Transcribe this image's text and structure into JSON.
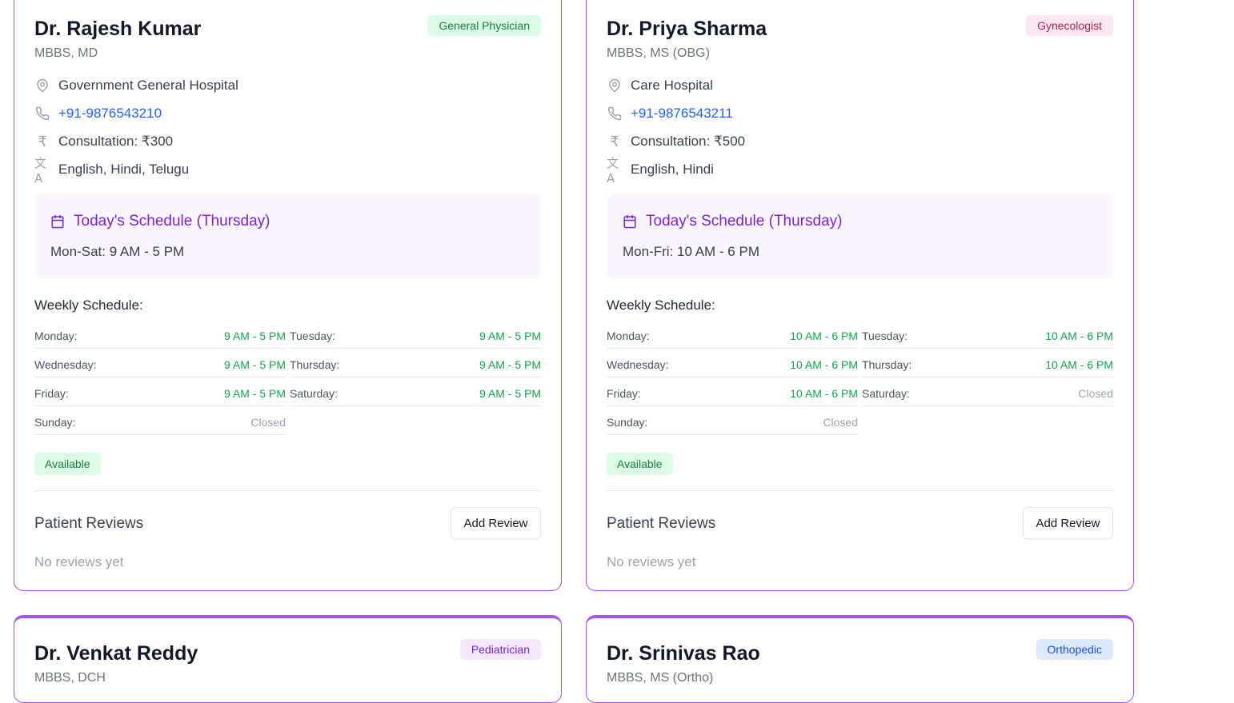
{
  "colors": {
    "accent": "#a855f7",
    "available_bg": "#dcfce7",
    "available_text": "#15803d",
    "schedule_bg": "#faf5ff",
    "hours_green": "#16a34a",
    "phone_blue": "#2563eb"
  },
  "doctors": [
    {
      "name": "Dr. Rajesh Kumar",
      "degree": "MBBS, MD",
      "specialty": "General Physician",
      "hospital": "Government General Hospital",
      "phone": "+91-9876543210",
      "consultation": "Consultation: ₹300",
      "languages": "English, Hindi, Telugu",
      "today_title": "Today's Schedule (Thursday)",
      "today_hours": "Mon-Sat: 9 AM - 5 PM",
      "weekly_title": "Weekly Schedule:",
      "schedule": [
        {
          "day": "Monday:",
          "hours": "9 AM - 5 PM"
        },
        {
          "day": "Tuesday:",
          "hours": "9 AM - 5 PM"
        },
        {
          "day": "Wednesday:",
          "hours": "9 AM - 5 PM"
        },
        {
          "day": "Thursday:",
          "hours": "9 AM - 5 PM"
        },
        {
          "day": "Friday:",
          "hours": "9 AM - 5 PM"
        },
        {
          "day": "Saturday:",
          "hours": "9 AM - 5 PM"
        },
        {
          "day": "Sunday:",
          "hours": "Closed"
        }
      ],
      "status": "Available",
      "reviews_title": "Patient Reviews",
      "add_review": "Add Review",
      "no_reviews": "No reviews yet"
    },
    {
      "name": "Dr. Priya Sharma",
      "degree": "MBBS, MS (OBG)",
      "specialty": "Gynecologist",
      "hospital": "Care Hospital",
      "phone": "+91-9876543211",
      "consultation": "Consultation: ₹500",
      "languages": "English, Hindi",
      "today_title": "Today's Schedule (Thursday)",
      "today_hours": "Mon-Fri: 10 AM - 6 PM",
      "weekly_title": "Weekly Schedule:",
      "schedule": [
        {
          "day": "Monday:",
          "hours": "10 AM - 6 PM"
        },
        {
          "day": "Tuesday:",
          "hours": "10 AM - 6 PM"
        },
        {
          "day": "Wednesday:",
          "hours": "10 AM - 6 PM"
        },
        {
          "day": "Thursday:",
          "hours": "10 AM - 6 PM"
        },
        {
          "day": "Friday:",
          "hours": "10 AM - 6 PM"
        },
        {
          "day": "Saturday:",
          "hours": "Closed"
        },
        {
          "day": "Sunday:",
          "hours": "Closed"
        }
      ],
      "status": "Available",
      "reviews_title": "Patient Reviews",
      "add_review": "Add Review",
      "no_reviews": "No reviews yet"
    },
    {
      "name": "Dr. Venkat Reddy",
      "degree": "MBBS, DCH",
      "specialty": "Pediatrician"
    },
    {
      "name": "Dr. Srinivas Rao",
      "degree": "MBBS, MS (Ortho)",
      "specialty": "Orthopedic"
    }
  ]
}
